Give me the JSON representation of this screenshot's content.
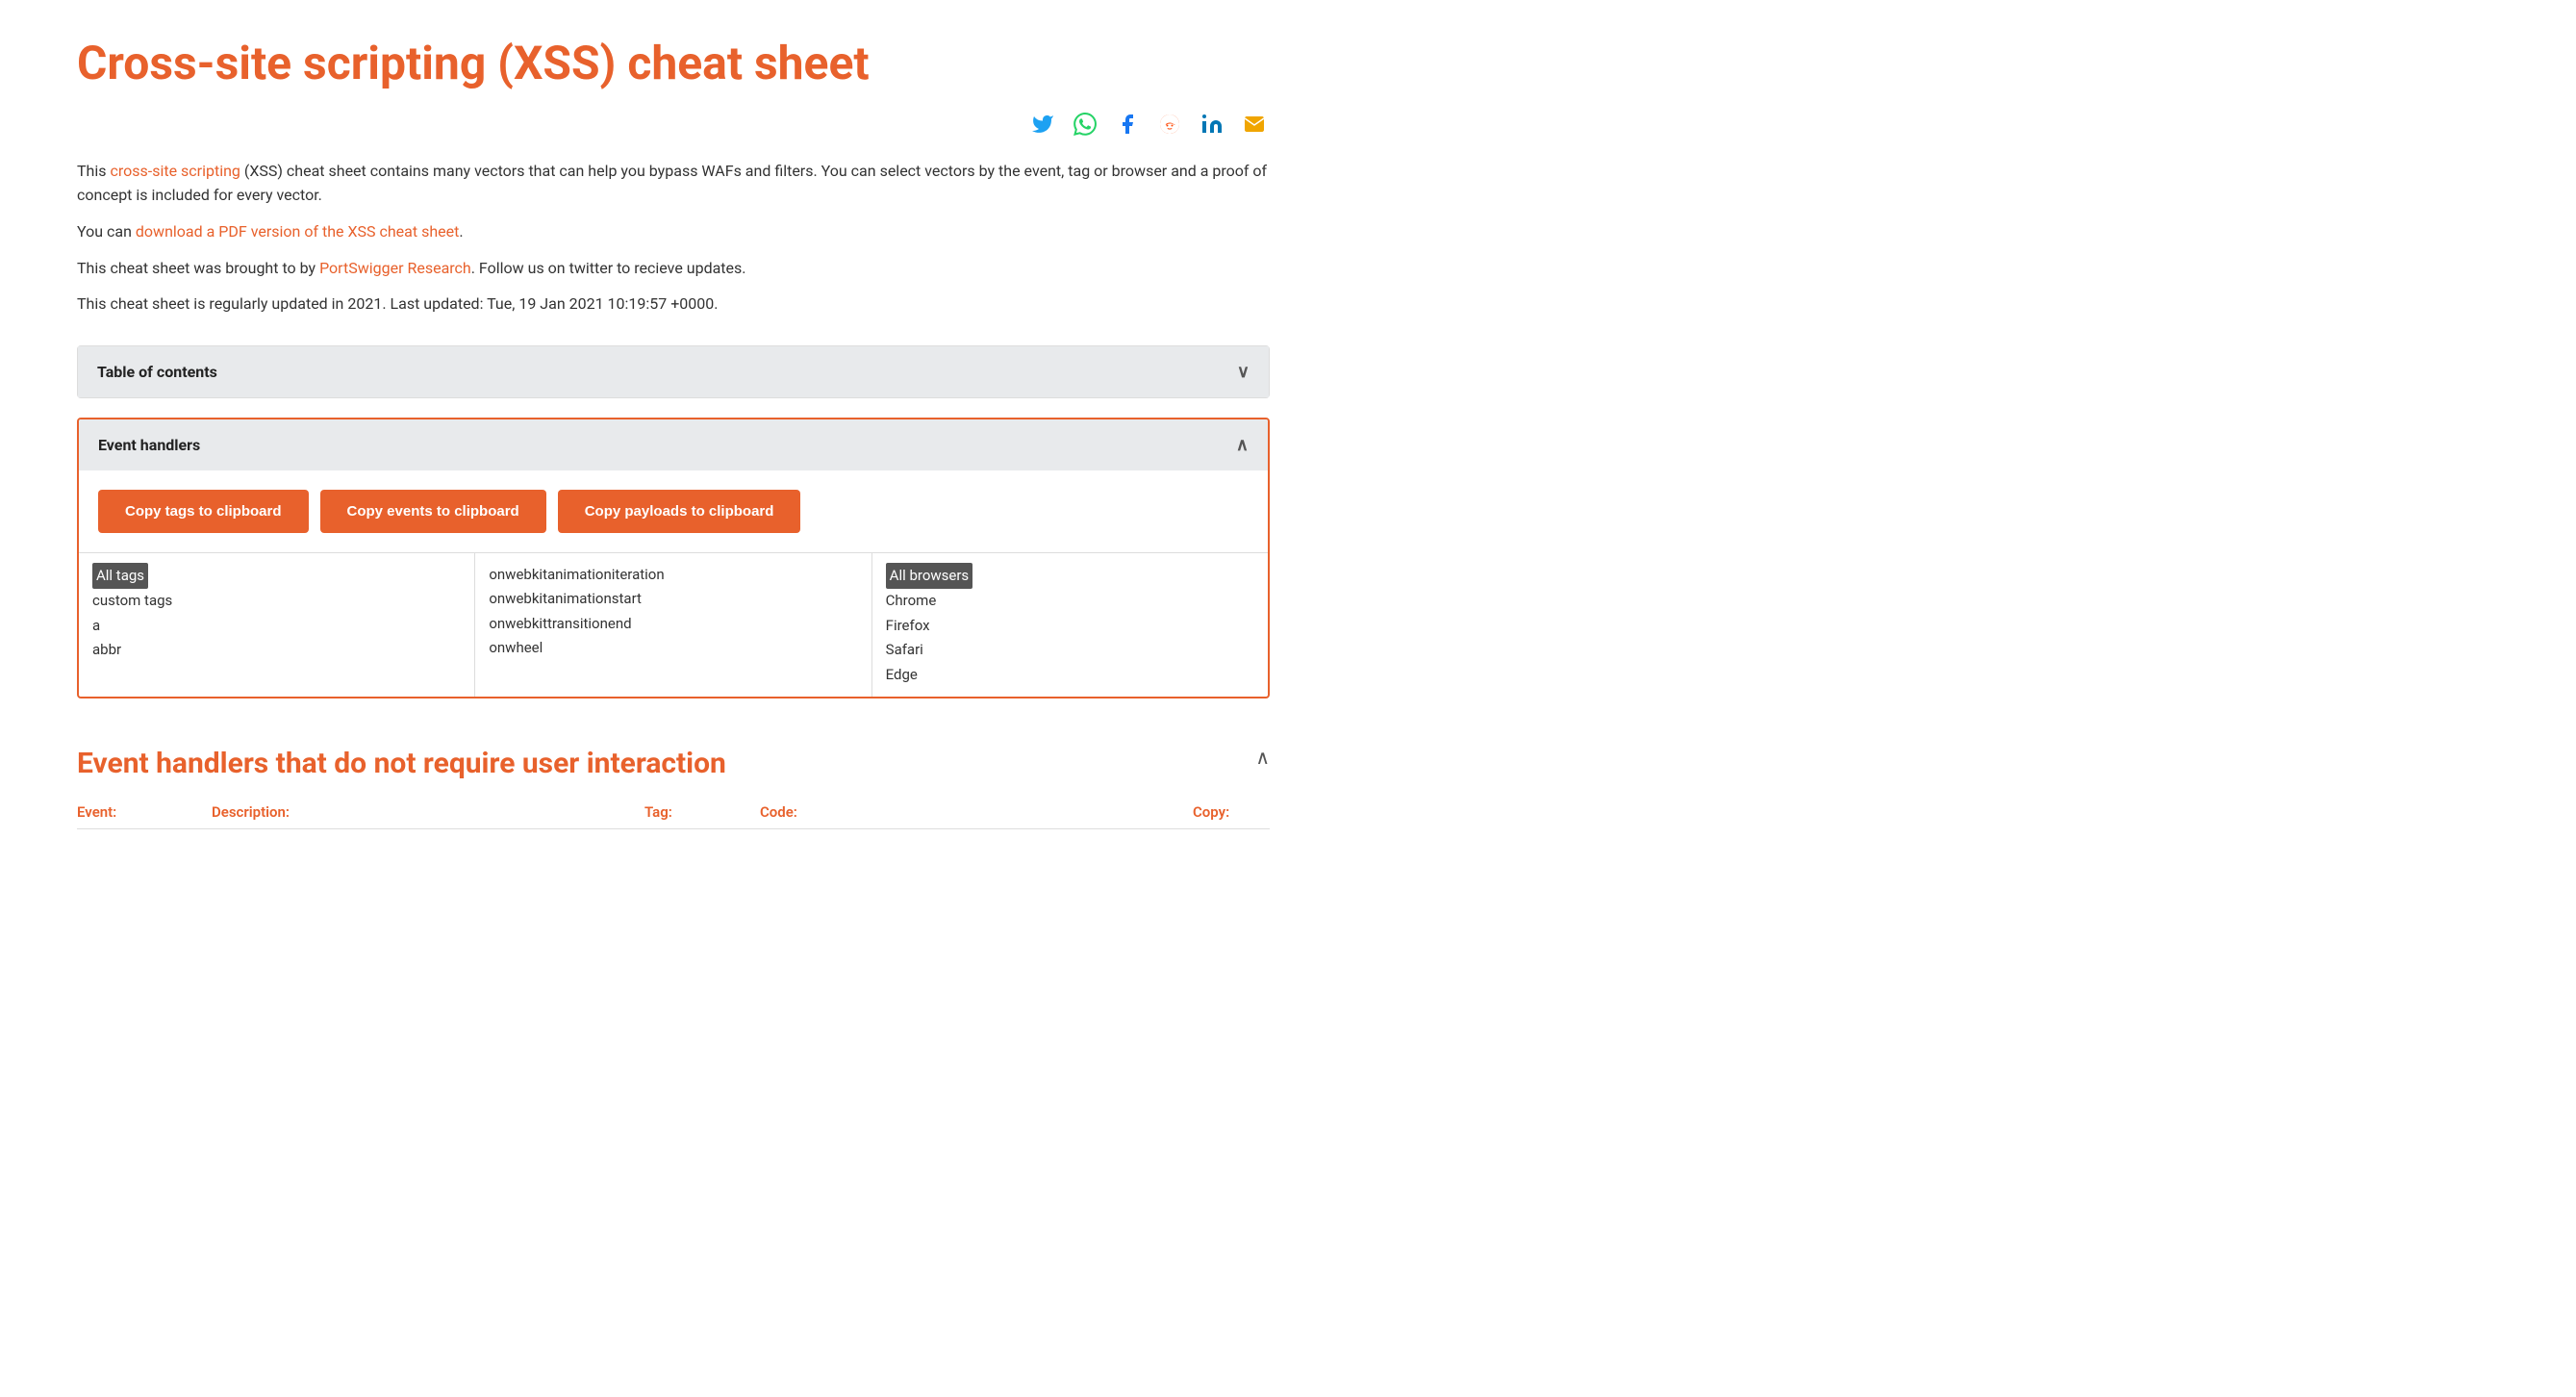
{
  "page": {
    "title": "Cross-site scripting (XSS) cheat sheet",
    "intro1_prefix": "This ",
    "intro1_link_text": "cross-site scripting",
    "intro1_suffix": " (XSS) cheat sheet contains many vectors that can help you bypass WAFs and filters. You can select vectors by the event, tag or browser and a proof of concept is included for every vector.",
    "intro2_prefix": "You can ",
    "intro2_link_text": "download a PDF version of the XSS cheat sheet",
    "intro2_suffix": ".",
    "intro3_prefix": "This cheat sheet was brought to by ",
    "intro3_link_text": "PortSwigger Research",
    "intro3_suffix": ". Follow us on twitter to recieve updates.",
    "intro4": "This cheat sheet is regularly updated in 2021. Last updated: Tue, 19 Jan 2021 10:19:57 +0000."
  },
  "social": {
    "twitter_label": "𝕏",
    "whatsapp_label": "●",
    "facebook_label": "f",
    "reddit_label": "●",
    "linkedin_label": "in",
    "email_label": "✉"
  },
  "toc": {
    "header": "Table of contents",
    "chevron": "∨"
  },
  "eventHandlers": {
    "header": "Event handlers",
    "chevron": "∧",
    "btn_tags": "Copy tags to clipboard",
    "btn_events": "Copy events to clipboard",
    "btn_payloads": "Copy payloads to clipboard",
    "tags_col": {
      "items": [
        "All tags",
        "custom tags",
        "a",
        "abbr"
      ]
    },
    "events_col": {
      "items": [
        "onwebkitanimationiteration",
        "onwebkitanimationstart",
        "onwebkittransitionend",
        "onwheel"
      ]
    },
    "browsers_col": {
      "items": [
        "All browsers",
        "Chrome",
        "Firefox",
        "Safari",
        "Edge"
      ]
    }
  },
  "subSection": {
    "title": "Event handlers that do not require user interaction",
    "chevron": "∧",
    "col_event": "Event:",
    "col_description": "Description:",
    "col_tag": "Tag:",
    "col_code": "Code:",
    "col_copy": "Copy:"
  }
}
